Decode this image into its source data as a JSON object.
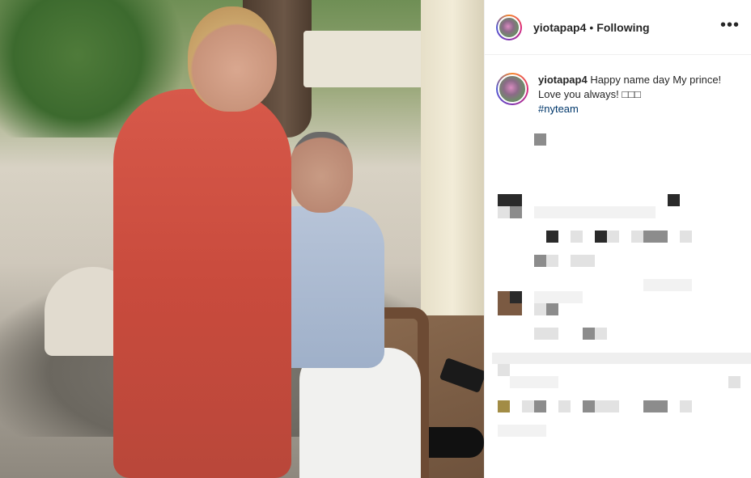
{
  "post": {
    "username": "yiotapap4",
    "separator": "•",
    "follow_status": "Following",
    "more_icon": "more-options-icon"
  },
  "caption": {
    "username": "yiotapap4",
    "text": "Happy name day My prince! Love you always! □□□",
    "hashtag": "#nyteam"
  },
  "colors": {
    "primary_text": "#262626",
    "link": "#00376b",
    "border": "#efefef"
  }
}
